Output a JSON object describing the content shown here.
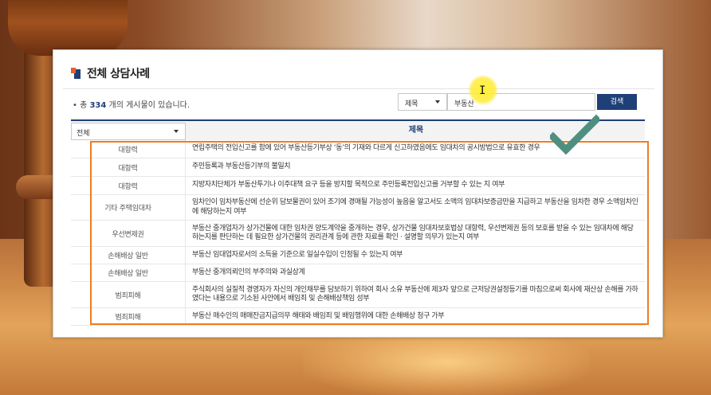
{
  "panel": {
    "title": "전체 상담사례",
    "count_prefix": "• 총 ",
    "count_value": "334",
    "count_suffix": " 개의 게시물이 있습니다."
  },
  "search": {
    "field_select": "제목",
    "query": "부동산",
    "button_label": "검색"
  },
  "table": {
    "category_select": "전체",
    "header_title": "제목",
    "rows": [
      {
        "category": "대항력",
        "title": "연립주택의 전입신고를 함에 있어 부동산등기부상 ‘동’의 기재와 다르게 신고하였음에도 임대차의 공시방법으로 유효한 경우"
      },
      {
        "category": "대항력",
        "title": "주민등록과 부동산등기부의 불일치"
      },
      {
        "category": "대항력",
        "title": "지방자치단체가 부동산투기나 이주대책 요구 등을 방지할 목적으로 주민등록전입신고를 거부할 수 있는 지 여부"
      },
      {
        "category": "기타 주택임대차",
        "title": "임차인이 임차부동산에 선순위 담보물권이 있어 조기에 경매될 가능성이 높음을 알고서도 소액의 임대차보증금만을 지급하고 부동산을 임차한 경우 소액임차인에 해당하는지 여부"
      },
      {
        "category": "우선변제권",
        "title": "부동산 중개업자가 상가건물에 대한 임차권 양도계약을 중개하는 경우, 상가건물 임대차보호법상 대항력, 우선변제권 등의 보호를 받을 수 있는 임대차에 해당하는지를 판단하는 데 필요한 상가건물의 권리관계 등에 관한 자료를 확인 · 설명할 의무가 있는지 여부"
      },
      {
        "category": "손해배상 일반",
        "title": "부동산 임대업자로서의 소득을 기준으로 일실수입이 인정될 수 있는지 여부"
      },
      {
        "category": "손해배상 일반",
        "title": "부동산 중개의뢰인의 부주의와 과실상계"
      },
      {
        "category": "범죄피해",
        "title": "주식회사의 실질적 경영자가 자신의 개인채무를 담보하기 위하여 회사 소유 부동산에 제3자 앞으로 근저당권설정등기를 마침으로써 회사에 재산상 손해를 가하였다는 내용으로 기소된 사안에서 배임죄 및 손해배상책임 성부"
      },
      {
        "category": "범죄피해",
        "title": "부동산 매수인의 매매잔금지급의무 해태와 배임죄 및 배임행위에 대한 손해배상 청구 가부"
      }
    ]
  },
  "colors": {
    "accent_blue": "#1f3f77",
    "accent_orange": "#e4632a",
    "highlight_orange": "#f07c20",
    "check_teal": "#4f8f80",
    "cursor_yellow": "#ffee33"
  },
  "icons": {
    "title_mark": "title-square-icon",
    "dropdown": "chevron-down-icon",
    "cursor": "text-cursor-icon",
    "check": "check-mark-icon"
  }
}
